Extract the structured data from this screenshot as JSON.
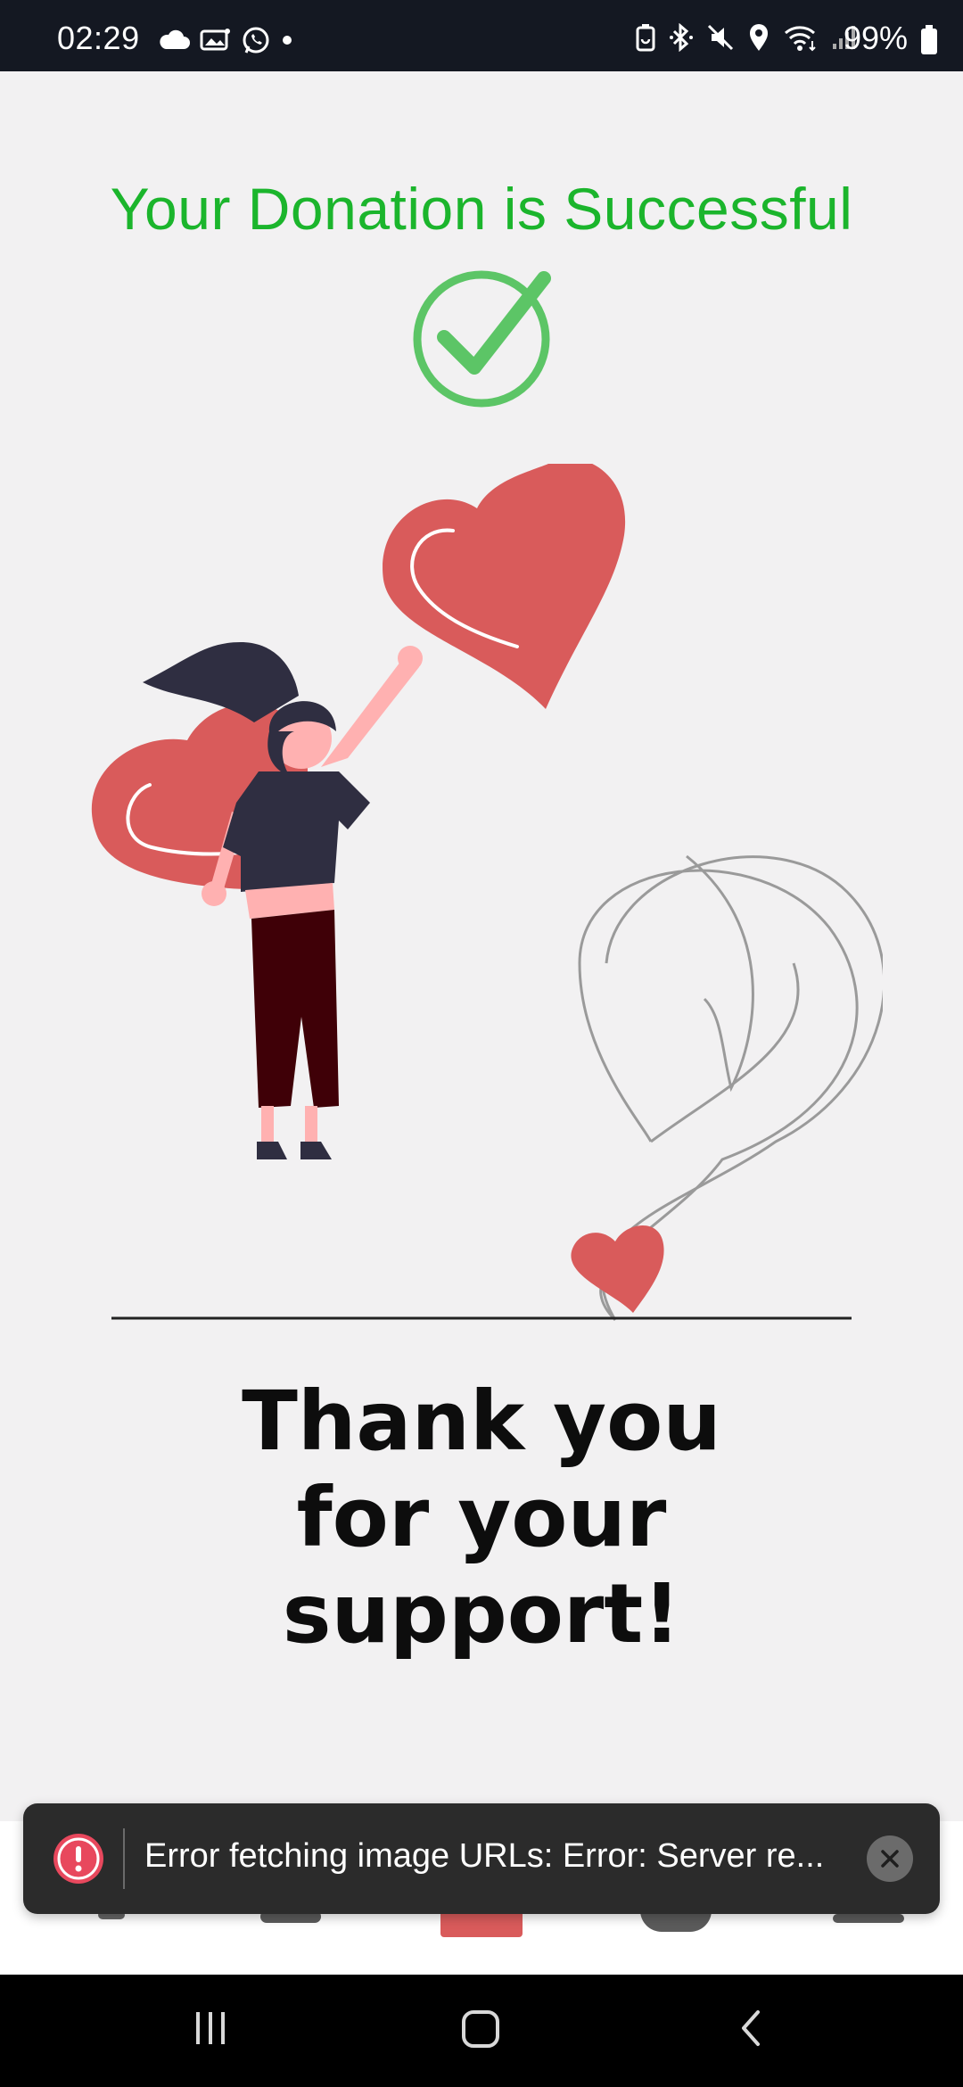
{
  "status_bar": {
    "time": "02:29",
    "battery": "99%",
    "left_icons": [
      "cloud-icon",
      "gallery-icon",
      "whatsapp-icon",
      "dot-icon"
    ],
    "right_icons": [
      "battery-saver-icon",
      "bluetooth-icon",
      "mute-icon",
      "location-icon",
      "wifi-icon",
      "signal-icon",
      "battery-icon"
    ]
  },
  "page": {
    "title": "Your Donation is Successful",
    "thanks_line1": "Thank you",
    "thanks_line2": "for your",
    "thanks_line3": "support!"
  },
  "toast": {
    "message": "Error fetching image URLs: Error: Server re...",
    "icon": "alert-icon",
    "close_icon": "close-icon"
  },
  "colors": {
    "success_green": "#1bb52c",
    "check_green": "#5cc566",
    "heart_red": "#d95b5b",
    "background": "#f2f1f2"
  }
}
